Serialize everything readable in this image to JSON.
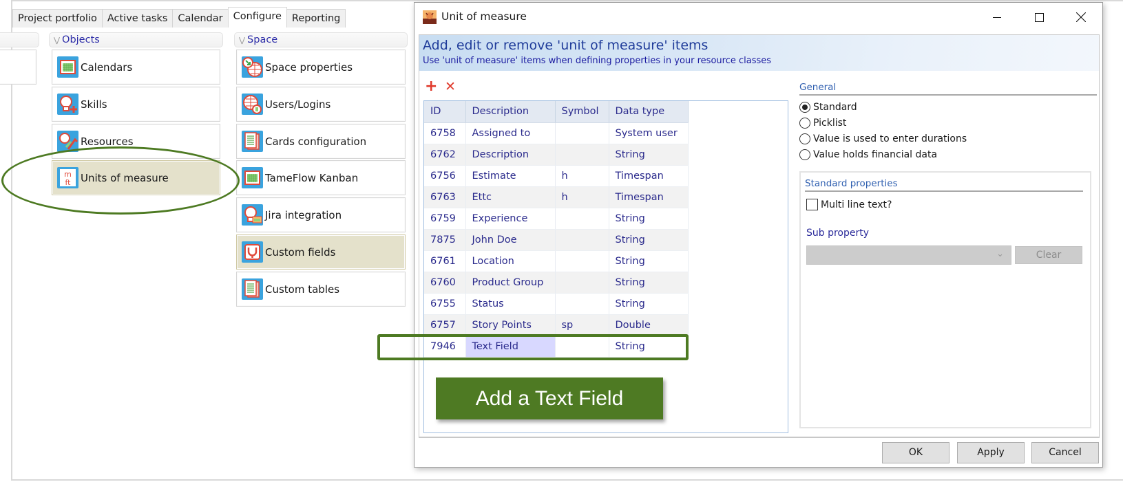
{
  "app": {
    "tabs": [
      {
        "label": "Project portfolio",
        "active": false
      },
      {
        "label": "Active tasks",
        "active": false
      },
      {
        "label": "Calendar",
        "active": false
      },
      {
        "label": "Configure",
        "active": true
      },
      {
        "label": "Reporting",
        "active": false
      }
    ],
    "objects": {
      "header": "Objects",
      "items": [
        {
          "label": "Calendars",
          "icon": "calendar-icon",
          "selected": false
        },
        {
          "label": "Skills",
          "icon": "skills-icon",
          "selected": false
        },
        {
          "label": "Resources",
          "icon": "resources-icon",
          "selected": false
        },
        {
          "label": "Units of measure",
          "icon": "units-of-measure-icon",
          "selected": true
        }
      ]
    },
    "space": {
      "header": "Space",
      "items": [
        {
          "label": "Space properties",
          "icon": "space-properties-icon",
          "selected": false
        },
        {
          "label": "Users/Logins",
          "icon": "users-logins-icon",
          "selected": false
        },
        {
          "label": "Cards configuration",
          "icon": "cards-configuration-icon",
          "selected": false
        },
        {
          "label": "TameFlow Kanban",
          "icon": "kanban-icon",
          "selected": false
        },
        {
          "label": "Jira integration",
          "icon": "jira-integration-icon",
          "selected": false
        },
        {
          "label": "Custom fields",
          "icon": "custom-fields-icon",
          "selected": true
        },
        {
          "label": "Custom tables",
          "icon": "custom-tables-icon",
          "selected": false
        }
      ]
    }
  },
  "dialog": {
    "title": "Unit of measure",
    "banner_title": "Add, edit or remove 'unit of measure' items",
    "banner_subtitle": "Use 'unit of measure' items when defining properties in your resource classes",
    "toolbar": {
      "add_symbol": "+",
      "remove_symbol": "✕"
    },
    "table": {
      "columns": [
        "ID",
        "Description",
        "Symbol",
        "Data type"
      ],
      "rows": [
        {
          "id": "6758",
          "description": "Assigned to",
          "symbol": "",
          "type": "System user"
        },
        {
          "id": "6762",
          "description": "Description",
          "symbol": "",
          "type": "String"
        },
        {
          "id": "6756",
          "description": "Estimate",
          "symbol": "h",
          "type": "Timespan"
        },
        {
          "id": "6763",
          "description": "Ettc",
          "symbol": "h",
          "type": "Timespan"
        },
        {
          "id": "6759",
          "description": "Experience",
          "symbol": "",
          "type": "String"
        },
        {
          "id": "7875",
          "description": "John Doe",
          "symbol": "",
          "type": "String"
        },
        {
          "id": "6761",
          "description": "Location",
          "symbol": "",
          "type": "String"
        },
        {
          "id": "6760",
          "description": "Product Group",
          "symbol": "",
          "type": "String"
        },
        {
          "id": "6755",
          "description": "Status",
          "symbol": "",
          "type": "String"
        },
        {
          "id": "6757",
          "description": "Story Points",
          "symbol": "sp",
          "type": "Double"
        },
        {
          "id": "7946",
          "description": "Text Field",
          "symbol": "",
          "type": "String",
          "selected": true
        }
      ]
    },
    "general": {
      "label": "General",
      "options": [
        {
          "label": "Standard",
          "checked": true
        },
        {
          "label": "Picklist",
          "checked": false
        },
        {
          "label": "Value is used to enter durations",
          "checked": false
        },
        {
          "label": "Value holds financial data",
          "checked": false
        }
      ]
    },
    "standard_properties": {
      "label": "Standard properties",
      "multiline_label": "Multi line text?",
      "multiline_checked": false,
      "sub_property_label": "Sub property",
      "sub_property_value": "",
      "clear_label": "Clear"
    },
    "buttons": {
      "ok": "OK",
      "apply": "Apply",
      "cancel": "Cancel"
    }
  },
  "annotations": {
    "callout_text": "Add a Text Field",
    "accent_color": "#4e7a23"
  }
}
